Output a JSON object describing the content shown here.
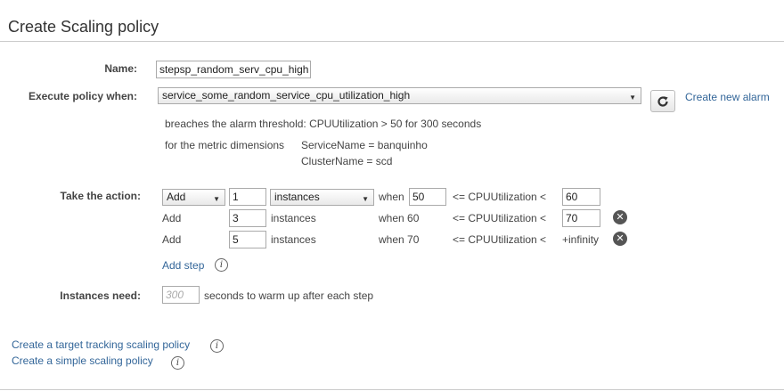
{
  "title": "Create Scaling policy",
  "name": {
    "label": "Name:",
    "value": "stepsp_random_serv_cpu_high"
  },
  "execute": {
    "label": "Execute policy when:",
    "selected_alarm": "service_some_random_service_cpu_utilization_high",
    "create_alarm_link": "Create new alarm",
    "breach_text": "breaches the alarm threshold: CPUUtilization > 50 for 300 seconds",
    "dimensions_label": "for the metric dimensions",
    "dimensions": [
      "ServiceName = banquinho",
      "ClusterName = scd"
    ]
  },
  "action": {
    "label": "Take the action:",
    "steps": [
      {
        "op": "Add",
        "amount": "1",
        "unit": "instances",
        "when": "when",
        "lower": "50",
        "cond": "<= CPUUtilization <",
        "upper": "60"
      },
      {
        "op": "Add",
        "amount": "3",
        "unit": "instances",
        "when": "when 60",
        "cond": "<= CPUUtilization <",
        "upper": "70"
      },
      {
        "op": "Add",
        "amount": "5",
        "unit": "instances",
        "when": "when 70",
        "cond": "<= CPUUtilization <",
        "upper": "+infinity"
      }
    ],
    "add_step_link": "Add step"
  },
  "warmup": {
    "label": "Instances need:",
    "placeholder": "300",
    "suffix": "seconds to warm up after each step"
  },
  "footer_links": {
    "target_tracking": "Create a target tracking scaling policy",
    "simple": "Create a simple scaling policy"
  },
  "icons": {
    "refresh": "refresh-icon",
    "info": "info-icon",
    "remove": "remove-icon"
  }
}
